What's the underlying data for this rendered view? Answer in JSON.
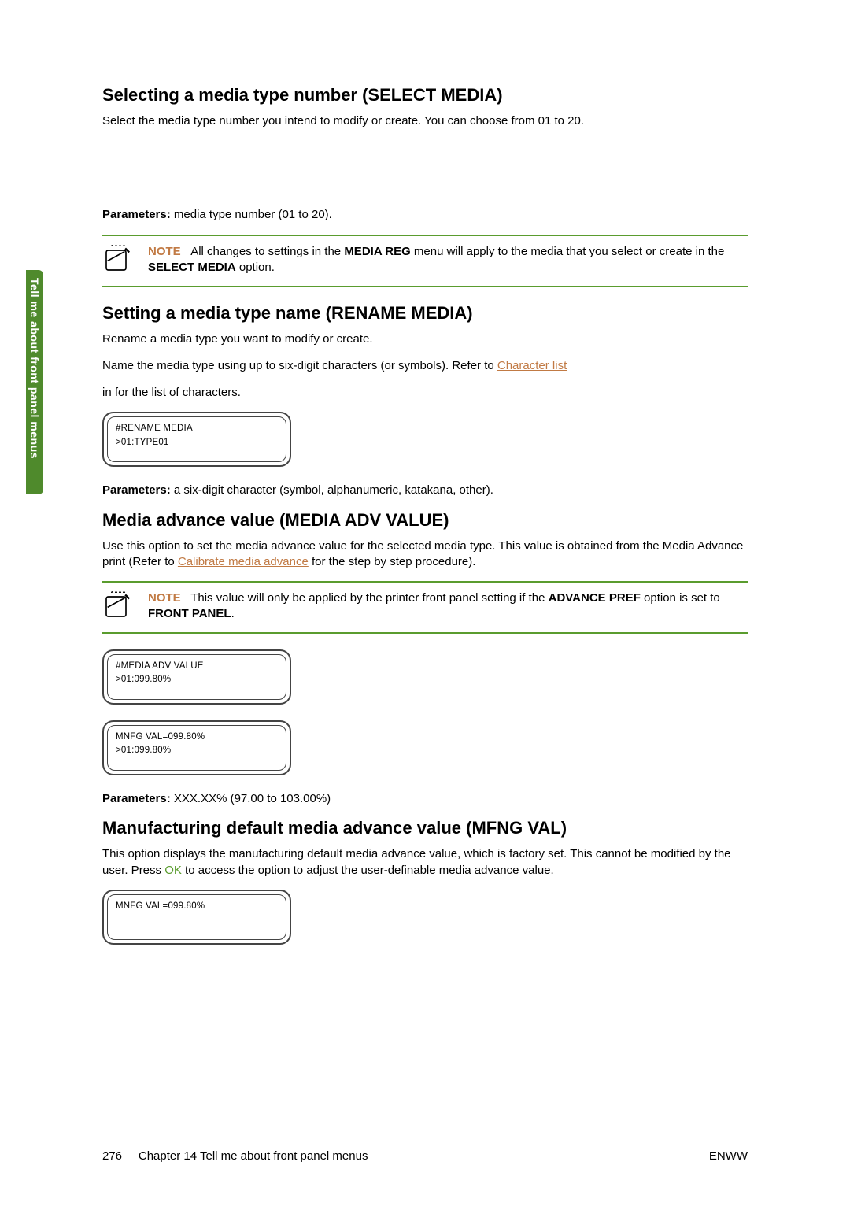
{
  "sideTab": "Tell me about front panel menus",
  "section1": {
    "heading": "Selecting a media type number (SELECT MEDIA)",
    "intro": "Select the media type number you intend to modify or create. You can choose from 01 to 20.",
    "paramsLabel": "Parameters:",
    "paramsText": " media type number (01 to 20).",
    "noteLabel": "NOTE",
    "noteBefore": "All changes to settings in the ",
    "noteBold1": "MEDIA REG",
    "noteMid": " menu will apply to the media that you select or create in the ",
    "noteBold2": "SELECT MEDIA",
    "noteAfter": " option."
  },
  "section2": {
    "heading": "Setting a media type name (RENAME MEDIA)",
    "line1": "Rename a media type you want to modify or create.",
    "line2a": "Name the media type using up to six-digit characters (or symbols). Refer to ",
    "link": "Character list",
    "line3": "in for the list of characters.",
    "display": {
      "l1": "#RENAME MEDIA",
      "l2": ">01:TYPE01"
    },
    "paramsLabel": "Parameters:",
    "paramsText": " a six-digit character (symbol, alphanumeric, katakana, other)."
  },
  "section3": {
    "heading": "Media advance value (MEDIA ADV VALUE)",
    "line1a": "Use this option to set the media advance value for the selected media type. This value is obtained from the Media Advance print (Refer to ",
    "link": "Calibrate media advance",
    "line1b": " for the step by step procedure).",
    "noteLabel": "NOTE",
    "noteBefore": "This value will only be applied by the printer front panel setting if the ",
    "noteBold1": "ADVANCE PREF",
    "noteMid": " option is set to ",
    "noteBold2": "FRONT PANEL",
    "noteAfter": ".",
    "display1": {
      "l1": "#MEDIA ADV VALUE",
      "l2": ">01:099.80%"
    },
    "display2": {
      "l1": "MNFG VAL=099.80%",
      "l2": ">01:099.80%"
    },
    "paramsLabel": "Parameters:",
    "paramsText": " XXX.XX% (97.00 to 103.00%)"
  },
  "section4": {
    "heading": "Manufacturing default media advance value (MFNG VAL)",
    "line1a": "This option displays the manufacturing default media advance value, which is factory set. This cannot be modified by the user. Press ",
    "ok": "OK",
    "line1b": " to access the option to adjust the user-definable media advance value.",
    "display": {
      "l1": "MNFG VAL=099.80%",
      "l2": ""
    }
  },
  "footer": {
    "pageNum": "276",
    "chapter": "Chapter 14   Tell me about front panel menus",
    "right": "ENWW"
  }
}
